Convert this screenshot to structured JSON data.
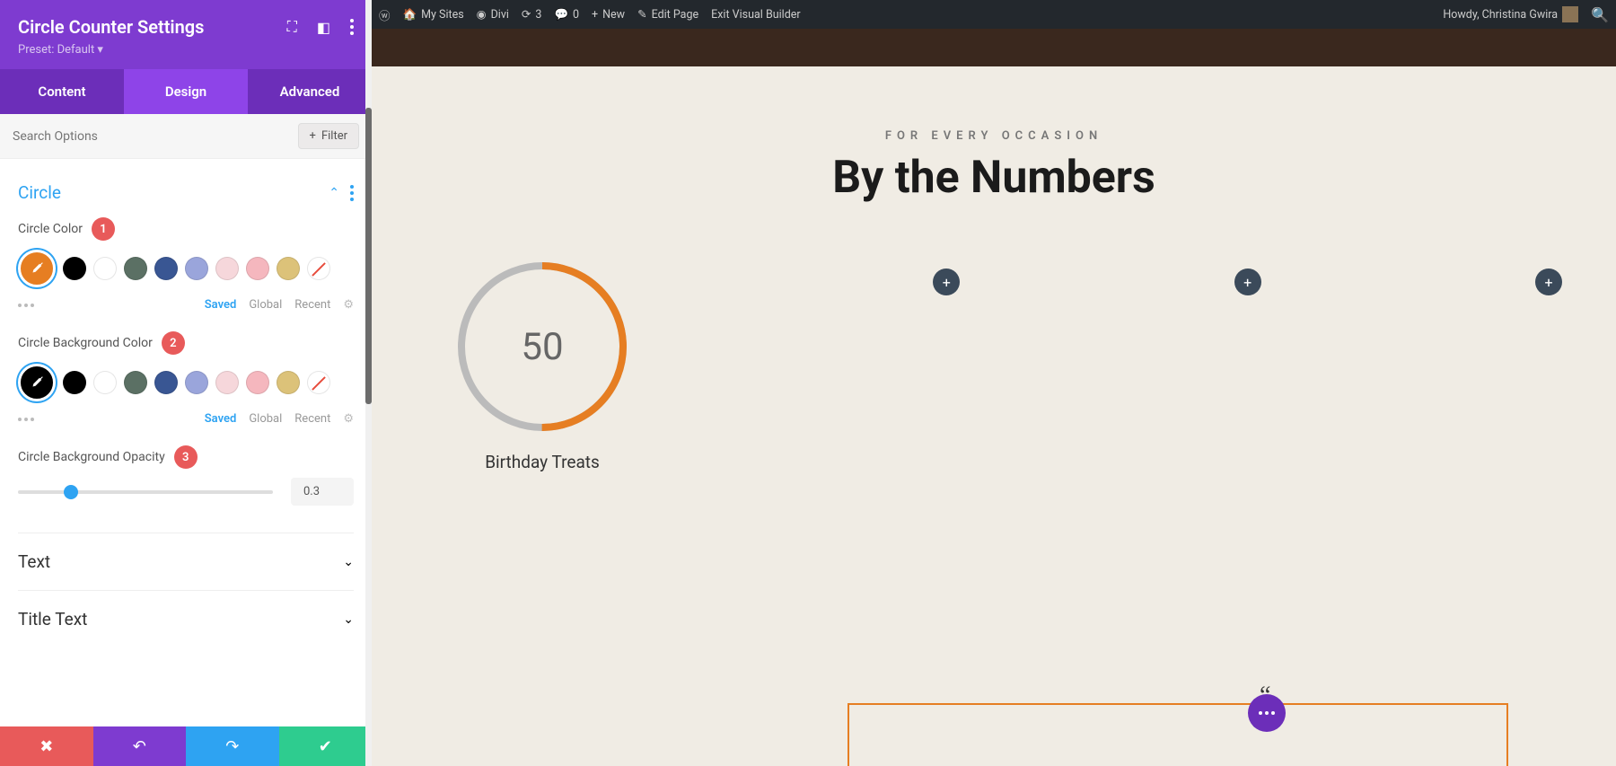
{
  "sidebar": {
    "title": "Circle Counter Settings",
    "preset": "Preset: Default ▾",
    "tabs": {
      "content": "Content",
      "design": "Design",
      "advanced": "Advanced"
    },
    "search_placeholder": "Search Options",
    "filter_label": "Filter",
    "sections": {
      "circle": {
        "title": "Circle"
      },
      "text": {
        "title": "Text"
      },
      "title_text": {
        "title": "Title Text"
      }
    },
    "fields": {
      "circle_color": {
        "label": "Circle Color",
        "badge": "1"
      },
      "circle_bg_color": {
        "label": "Circle Background Color",
        "badge": "2"
      },
      "circle_bg_opacity": {
        "label": "Circle Background Opacity",
        "badge": "3",
        "value": "0.3"
      }
    },
    "palette": {
      "colors": [
        "#000000",
        "#ffffff",
        "#5b7064",
        "#395693",
        "#9aa5db",
        "#f6d7db",
        "#f5b7be",
        "#dcc279"
      ],
      "selected1": "#e67e22",
      "selected2": "#000000",
      "saved": "Saved",
      "global": "Global",
      "recent": "Recent"
    }
  },
  "adminbar": {
    "mysites": "My Sites",
    "divi": "Divi",
    "updates": "3",
    "comments": "0",
    "new": "New",
    "edit": "Edit Page",
    "exit": "Exit Visual Builder",
    "howdy": "Howdy, Christina Gwira"
  },
  "preview": {
    "eyebrow": "FOR EVERY OCCASION",
    "headline": "By the Numbers",
    "counter": {
      "value": "50",
      "label": "Birthday Treats",
      "percent": 50,
      "color": "#e67e22",
      "bg": "#bbb"
    }
  }
}
